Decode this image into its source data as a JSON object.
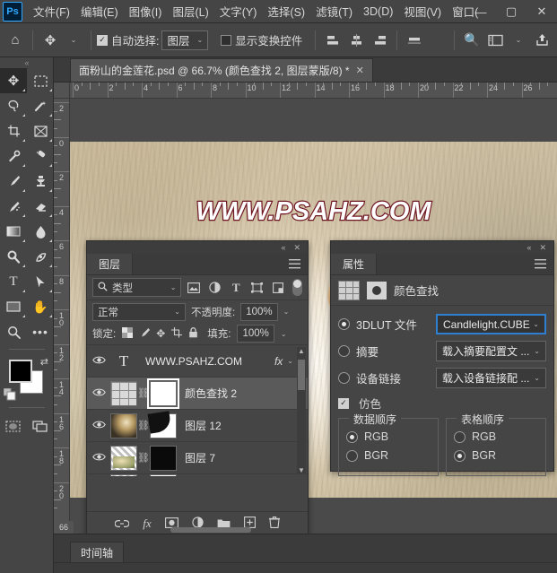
{
  "app": {
    "logo": "Ps",
    "menus": [
      "文件(F)",
      "编辑(E)",
      "图像(I)",
      "图层(L)",
      "文字(Y)",
      "选择(S)",
      "滤镜(T)",
      "3D(D)",
      "视图(V)",
      "窗口("
    ],
    "window_buttons": {
      "minimize": "—",
      "maximize": "▢",
      "close": "✕"
    }
  },
  "options_bar": {
    "home_icon": "home-icon",
    "tool_icon": "move-tool-icon",
    "auto_select_checked": true,
    "auto_select_label": "自动选择:",
    "auto_select_value": "图层",
    "show_transform_checked": false,
    "show_transform_label": "显示变换控件",
    "align_icons": [
      "align-left-icon",
      "align-center-icon",
      "align-right-icon",
      "align-bottom-icon"
    ],
    "search_icon": "search-icon",
    "workspace_icon": "arrange-documents-icon",
    "share_icon": "share-icon"
  },
  "toolbox": {
    "grip": "«",
    "tools": [
      {
        "name": "move-tool",
        "glyph": "✥",
        "active": true,
        "corner": true
      },
      {
        "name": "rectangular-marquee-tool",
        "glyph": "⬚",
        "active": false,
        "corner": true
      },
      {
        "name": "lasso-tool",
        "glyph": "◯",
        "active": false,
        "corner": true
      },
      {
        "name": "magic-wand-tool",
        "glyph": "✦",
        "active": false,
        "corner": true
      },
      {
        "name": "crop-tool",
        "glyph": "⌗",
        "active": false,
        "corner": true
      },
      {
        "name": "slice-tool",
        "glyph": "⊠",
        "active": false,
        "corner": true
      },
      {
        "name": "eyedropper-tool",
        "glyph": "⚲",
        "active": false,
        "corner": true
      },
      {
        "name": "healing-brush-tool",
        "glyph": "✎",
        "active": false,
        "corner": true
      },
      {
        "name": "brush-tool",
        "glyph": "🖌",
        "active": false,
        "corner": true
      },
      {
        "name": "clone-stamp-tool",
        "glyph": "⚑",
        "active": false,
        "corner": true
      },
      {
        "name": "history-brush-tool",
        "glyph": "❧",
        "active": false,
        "corner": true
      },
      {
        "name": "eraser-tool",
        "glyph": "▰",
        "active": false,
        "corner": true
      },
      {
        "name": "gradient-tool",
        "glyph": "▭",
        "active": false,
        "corner": true
      },
      {
        "name": "blur-tool",
        "glyph": "💧",
        "active": false,
        "corner": true
      },
      {
        "name": "dodge-tool",
        "glyph": "⚭",
        "active": false,
        "corner": true
      },
      {
        "name": "pen-tool",
        "glyph": "✒",
        "active": false,
        "corner": true
      },
      {
        "name": "horizontal-type-tool",
        "glyph": "T",
        "active": false,
        "corner": true
      },
      {
        "name": "path-selection-tool",
        "glyph": "➤",
        "active": false,
        "corner": true
      },
      {
        "name": "rectangle-tool",
        "glyph": "▭",
        "active": false,
        "corner": true
      },
      {
        "name": "hand-tool",
        "glyph": "✋",
        "active": false,
        "corner": false
      },
      {
        "name": "zoom-tool",
        "glyph": "🔍",
        "active": false,
        "corner": false
      },
      {
        "name": "edit-toolbar-tool",
        "glyph": "•••",
        "active": false,
        "corner": false
      }
    ],
    "foreground_color": "#000000",
    "background_color": "#ffffff",
    "swap_icon": "swap-colors-icon",
    "default_colors_icon": "default-colors-icon",
    "quick_mask_icon": "quick-mask-icon",
    "screen_mode_icon": "screen-mode-icon"
  },
  "document": {
    "tab_title": "面粉山的金莲花.psd @ 66.7% (颜色查找 2, 图层蒙版/8) *",
    "close_glyph": "✕",
    "zoom_percent": "66.7%",
    "watermark_text": "WWW.PSAHZ.COM",
    "watermark_color": "#ffffff",
    "watermark_stroke": "#6e1320"
  },
  "rulers": {
    "unit": "cm",
    "horizontal_labels": [
      "0",
      "2",
      "4",
      "6",
      "8",
      "10",
      "12",
      "14",
      "16",
      "18",
      "20",
      "22",
      "24",
      "26"
    ],
    "vertical_labels": [
      "2",
      "0",
      "2",
      "4",
      "6",
      "8",
      "10",
      "12",
      "14",
      "16",
      "18",
      "20"
    ],
    "status_value": "66"
  },
  "layers_panel": {
    "grip_collapse": "«",
    "grip_close": "✕",
    "tab_label": "图层",
    "menu_icon": "panel-menu-icon",
    "filter": {
      "search_icon": "search-icon",
      "type_value": "类型",
      "icons": [
        "filter-pixel-icon",
        "filter-adjustment-icon",
        "filter-type-icon",
        "filter-shape-icon",
        "filter-smart-object-icon"
      ],
      "toggle_on": false
    },
    "blend_mode": "正常",
    "opacity_label": "不透明度:",
    "opacity_value": "100%",
    "lock_label": "锁定:",
    "lock_icons": [
      "lock-transparent-pixels-icon",
      "lock-image-pixels-icon",
      "lock-position-icon",
      "lock-artboard-icon",
      "lock-all-icon"
    ],
    "fill_label": "填充:",
    "fill_value": "100%",
    "layers": [
      {
        "name": "WWW.PSAHZ.COM",
        "type": "text",
        "visible": true,
        "selected": false,
        "has_fx": true,
        "fx_label": "fx",
        "expand": "⌄"
      },
      {
        "name": "颜色查找 2",
        "type": "color-lookup",
        "visible": true,
        "selected": true,
        "has_fx": false,
        "mask": "white"
      },
      {
        "name": "图层 12",
        "type": "image",
        "visible": true,
        "selected": false,
        "has_fx": false,
        "mask": "curve"
      },
      {
        "name": "图层 7",
        "type": "image",
        "visible": true,
        "selected": false,
        "has_fx": false,
        "mask": "black"
      }
    ],
    "footer_icons": [
      "link-layers-icon",
      "add-layer-style-icon",
      "add-layer-mask-icon",
      "new-adjustment-layer-icon",
      "new-group-icon",
      "new-layer-icon",
      "delete-layer-icon"
    ],
    "footer_fx_label": "fx"
  },
  "properties_panel": {
    "grip_collapse": "«",
    "grip_close": "✕",
    "tab_label": "属性",
    "menu_icon": "panel-menu-icon",
    "header_title": "颜色查找",
    "lut_icon": "color-lookup-icon",
    "mask_icon": "layer-mask-icon",
    "options": [
      {
        "label": "3DLUT 文件",
        "selected": true,
        "value": "Candlelight.CUBE",
        "focused": true
      },
      {
        "label": "摘要",
        "selected": false,
        "value": "载入摘要配置文 ...",
        "focused": false
      },
      {
        "label": "设备链接",
        "selected": false,
        "value": "载入设备链接配 ...",
        "focused": false
      }
    ],
    "dither_label": "仿色",
    "dither_checked": true,
    "groups": [
      {
        "title": "数据顺序",
        "options": [
          {
            "label": "RGB",
            "selected": true
          },
          {
            "label": "BGR",
            "selected": false
          }
        ]
      },
      {
        "title": "表格顺序",
        "options": [
          {
            "label": "RGB",
            "selected": false
          },
          {
            "label": "BGR",
            "selected": true
          }
        ]
      }
    ],
    "accent_color": "#2f7fd0"
  },
  "timeline": {
    "tab_label": "时间轴"
  }
}
